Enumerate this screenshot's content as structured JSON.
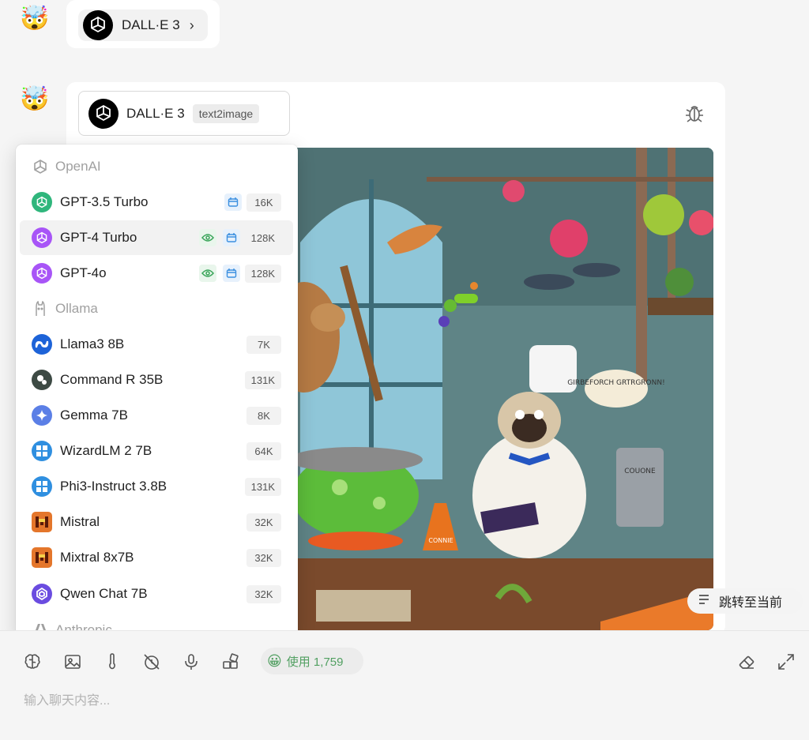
{
  "conversation": {
    "user_avatar_emoji": "🤯",
    "first_message": {
      "plugin_label": "DALL·E 3",
      "chevron": "›"
    },
    "second_message": {
      "tool_name": "DALL·E 3",
      "tool_tag": "text2image",
      "image_caption_text": "GIRBEFORCH GRTRGRONN!",
      "image_label_text": "COUONE",
      "flask_label": "CONNIE"
    }
  },
  "dropdown": {
    "groups": [
      {
        "provider": "OpenAI",
        "models": [
          {
            "name": "GPT-3.5 Turbo",
            "context": "16K",
            "vision": false,
            "functions": true,
            "active": false,
            "icon": "openai-green",
            "color": "#2fb67c"
          },
          {
            "name": "GPT-4 Turbo",
            "context": "128K",
            "vision": true,
            "functions": true,
            "active": true,
            "icon": "openai-purple",
            "color": "#a855f7"
          },
          {
            "name": "GPT-4o",
            "context": "128K",
            "vision": true,
            "functions": true,
            "active": false,
            "icon": "openai-purple",
            "color": "#a855f7"
          }
        ]
      },
      {
        "provider": "Ollama",
        "models": [
          {
            "name": "Llama3 8B",
            "context": "7K",
            "icon": "meta",
            "color": "#1d63d8"
          },
          {
            "name": "Command R 35B",
            "context": "131K",
            "icon": "cohere",
            "color": "#3d4a44"
          },
          {
            "name": "Gemma 7B",
            "context": "8K",
            "icon": "gemma",
            "color": "#5b7fe6"
          },
          {
            "name": "WizardLM 2 7B",
            "context": "64K",
            "icon": "microsoft",
            "color": "#2f8fe0"
          },
          {
            "name": "Phi3-Instruct 3.8B",
            "context": "131K",
            "icon": "microsoft",
            "color": "#2f8fe0"
          },
          {
            "name": "Mistral",
            "context": "32K",
            "icon": "mistral",
            "color": "#e4762b"
          },
          {
            "name": "Mixtral 8x7B",
            "context": "32K",
            "icon": "mistral",
            "color": "#e4762b"
          },
          {
            "name": "Qwen Chat 7B",
            "context": "32K",
            "icon": "qwen",
            "color": "#6a4ce0"
          }
        ]
      },
      {
        "provider": "Anthropic",
        "models": []
      }
    ]
  },
  "jump_button": {
    "label": "跳转至当前"
  },
  "toolbar": {
    "usage_emoji": "😀",
    "usage_label": "使用 1,759",
    "icons": [
      "brain-icon",
      "image-icon",
      "thermometer-icon",
      "history-off-icon",
      "microphone-icon",
      "plugins-icon",
      "eraser-icon",
      "expand-icon"
    ]
  },
  "input": {
    "placeholder": "输入聊天内容..."
  },
  "colors": {
    "accent_green": "#52a062",
    "vision_green": "#3aa55a",
    "function_blue": "#3b8fe0"
  }
}
